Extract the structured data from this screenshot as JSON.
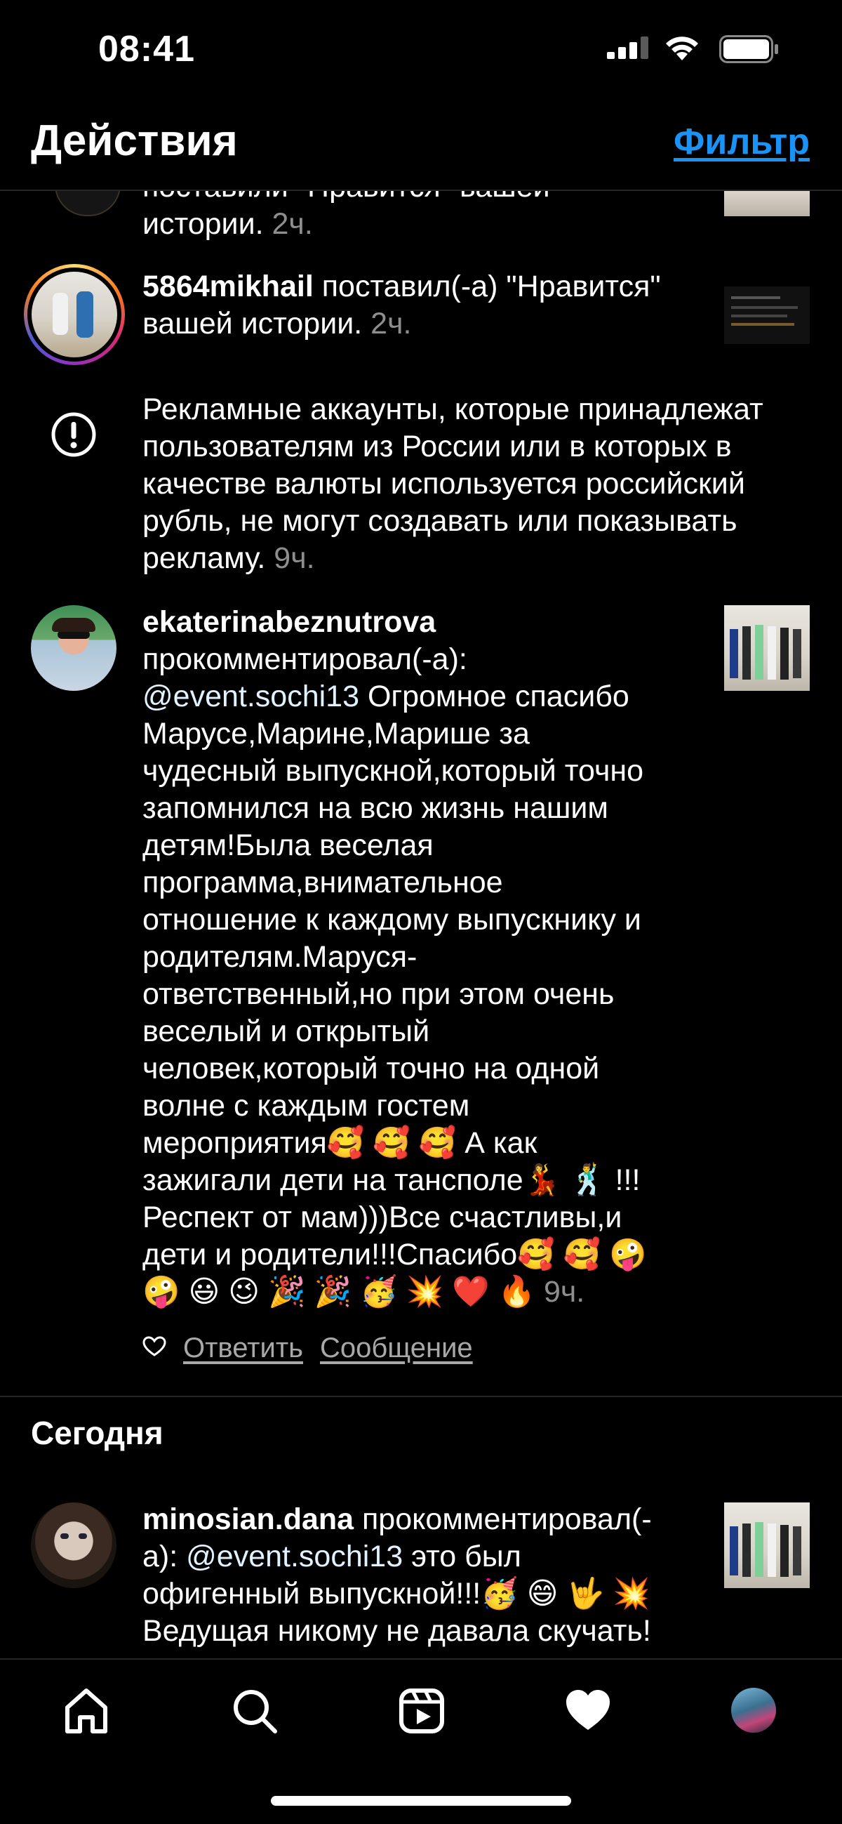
{
  "status_bar": {
    "time": "08:41"
  },
  "header": {
    "title": "Действия",
    "filter_label": "Фильтр"
  },
  "feed": {
    "item0": {
      "text": "поставили \"Нравится\" вашей",
      "text2": "истории.",
      "time": "2ч."
    },
    "item1": {
      "username": "5864mikhail",
      "line1_rest": " поставил(-а) \"Нравится\"",
      "line2": "вашей истории.",
      "time": "2ч."
    },
    "notice": {
      "lines": [
        "Рекламные аккаунты, которые принадлежат",
        "пользователям из России или в которых в",
        "качестве валюты используется российский",
        "рубль, не могут создавать или показывать",
        "рекламу."
      ],
      "time": "9ч."
    },
    "comment1": {
      "username": "ekaterinabeznutrova",
      "action": "прокомментировал(-а):",
      "mention": "@event.sochi13",
      "lines": [
        "  Огромное спасибо",
        "Марусе,Марине,Марише за",
        "чудесный выпускной,который точно",
        "запомнился на всю жизнь нашим",
        "детям!Была веселая",
        "программа,внимательное",
        "отношение к каждому выпускнику и",
        "родителям.Маруся-",
        "ответственный,но при этом очень",
        "веселый и открытый",
        "человек,который точно на одной",
        "волне с каждым гостем",
        "мероприятия🥰 🥰 🥰 А как",
        "зажигали дети на тансполе💃 🕺 !!!",
        "Респект от мам)))Все счастливы,и",
        "дети и родители!!!Спасибо🥰 🥰 🤪",
        "🤪 😃 😉 🎉 🎉 🥳 💥 ❤️ 🔥 "
      ],
      "time": "9ч.",
      "reply_label": "Ответить",
      "message_label": "Сообщение"
    },
    "section_today": "Сегодня",
    "comment2": {
      "username": "minosian.dana",
      "line1_rest": " прокомментировал(-",
      "line2_pre": "а): ",
      "mention": "@event.sochi13",
      "line2_rest": "  это был",
      "line3": "офигенный выпускной!!!🥳 😄 🤟 💥",
      "line4": "Ведущая никому не давала скучать!"
    }
  },
  "tabbar": {
    "tabs": [
      "home-icon",
      "search-icon",
      "reels-icon",
      "heart-icon",
      "profile-avatar"
    ]
  },
  "colors": {
    "accent": "#1a93f5",
    "background": "#000000",
    "muted": "#8e8e8e"
  }
}
